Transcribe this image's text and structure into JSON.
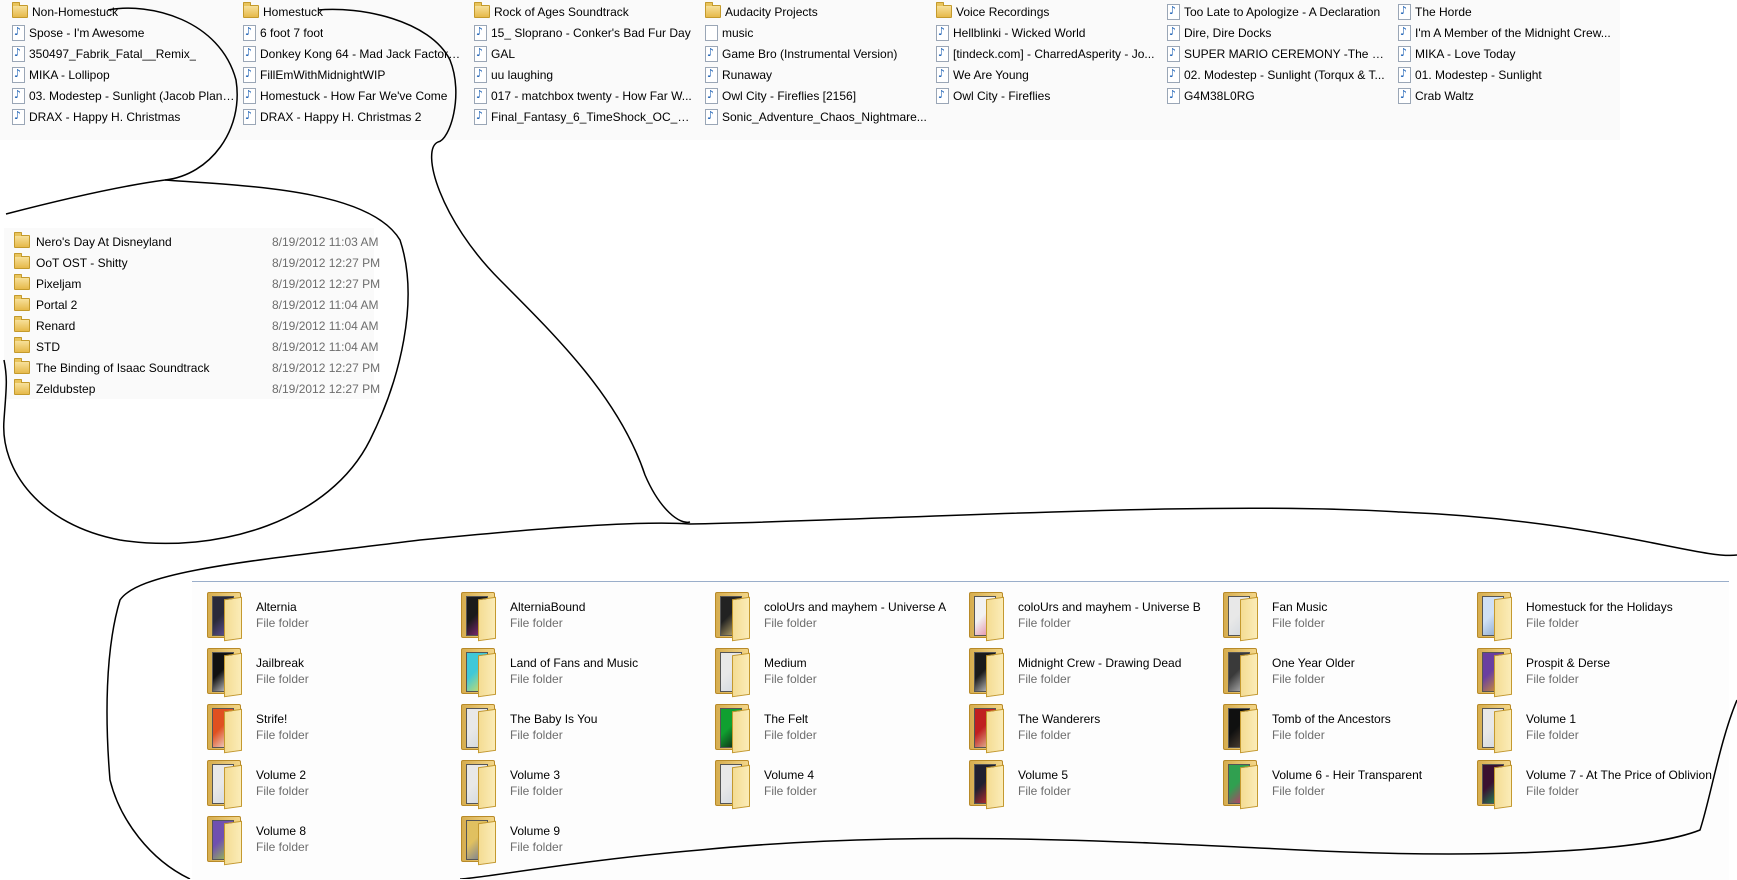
{
  "list_view": {
    "columns": [
      [
        {
          "label": "Non-Homestuck",
          "icon": "folder-icon"
        },
        {
          "label": "Spose - I'm Awesome",
          "icon": "audio-file-icon"
        },
        {
          "label": "350497_Fabrik_Fatal__Remix_",
          "icon": "audio-file-icon"
        },
        {
          "label": "MIKA - Lollipop",
          "icon": "audio-file-icon"
        },
        {
          "label": "03. Modestep - Sunlight (Jacob Plant...",
          "icon": "audio-file-icon"
        },
        {
          "label": "DRAX - Happy H. Christmas",
          "icon": "audio-file-icon"
        }
      ],
      [
        {
          "label": "Homestuck",
          "icon": "folder-icon"
        },
        {
          "label": "6 foot 7 foot",
          "icon": "audio-file-icon"
        },
        {
          "label": "Donkey Kong 64 - Mad Jack Factory ...",
          "icon": "audio-file-icon"
        },
        {
          "label": "FillEmWithMidnightWIP",
          "icon": "audio-file-icon"
        },
        {
          "label": "Homestuck - How Far We've Come",
          "icon": "audio-file-icon"
        },
        {
          "label": "DRAX - Happy H. Christmas 2",
          "icon": "audio-file-icon"
        }
      ],
      [
        {
          "label": "Rock of Ages Soundtrack",
          "icon": "folder-icon"
        },
        {
          "label": "15_ Sloprano - Conker's Bad Fur Day",
          "icon": "audio-file-icon"
        },
        {
          "label": "GAL",
          "icon": "audio-file-icon"
        },
        {
          "label": "uu laughing",
          "icon": "audio-file-icon"
        },
        {
          "label": "017 - matchbox twenty - How Far W...",
          "icon": "audio-file-icon"
        },
        {
          "label": "Final_Fantasy_6_TimeShock_OC_Re...",
          "icon": "audio-file-icon"
        }
      ],
      [
        {
          "label": "Audacity Projects",
          "icon": "folder-icon"
        },
        {
          "label": "music",
          "icon": "file-icon"
        },
        {
          "label": "Game Bro (Instrumental Version)",
          "icon": "audio-file-icon"
        },
        {
          "label": "Runaway",
          "icon": "audio-file-icon"
        },
        {
          "label": "Owl City - Fireflies  [2156]",
          "icon": "audio-file-icon"
        },
        {
          "label": "Sonic_Adventure_Chaos_Nightmare...",
          "icon": "audio-file-icon"
        }
      ],
      [
        {
          "label": "Voice Recordings",
          "icon": "folder-icon"
        },
        {
          "label": "Hellblinki - Wicked World",
          "icon": "audio-file-icon"
        },
        {
          "label": "[tindeck.com] - CharredAsperity - Jo...",
          "icon": "audio-file-icon"
        },
        {
          "label": "We Are Young",
          "icon": "audio-file-icon"
        },
        {
          "label": "Owl City - Fireflies",
          "icon": "audio-file-icon"
        }
      ],
      [
        {
          "label": "Too Late to Apologize - A Declaration",
          "icon": "audio-file-icon"
        },
        {
          "label": "Dire, Dire Docks",
          "icon": "audio-file-icon"
        },
        {
          "label": "SUPER MARIO CEREMONY -The 30t...",
          "icon": "audio-file-icon"
        },
        {
          "label": "02. Modestep - Sunlight (Torqux & T...",
          "icon": "audio-file-icon"
        },
        {
          "label": "G4M38L0RG",
          "icon": "audio-file-icon"
        }
      ],
      [
        {
          "label": "The Horde",
          "icon": "audio-file-icon"
        },
        {
          "label": "I'm A Member of the Midnight Crew...",
          "icon": "audio-file-icon"
        },
        {
          "label": "MIKA - Love Today",
          "icon": "audio-file-icon"
        },
        {
          "label": "01. Modestep - Sunlight",
          "icon": "audio-file-icon"
        },
        {
          "label": "Crab Waltz",
          "icon": "audio-file-icon"
        }
      ]
    ]
  },
  "details_view": {
    "rows": [
      {
        "name": "Nero's Day At Disneyland",
        "date": "8/19/2012 11:03 AM"
      },
      {
        "name": "OoT OST - Shitty",
        "date": "8/19/2012 12:27 PM"
      },
      {
        "name": "Pixeljam",
        "date": "8/19/2012 12:27 PM"
      },
      {
        "name": "Portal 2",
        "date": "8/19/2012 11:04 AM"
      },
      {
        "name": "Renard",
        "date": "8/19/2012 11:04 AM"
      },
      {
        "name": "STD",
        "date": "8/19/2012 11:04 AM"
      },
      {
        "name": "The Binding of Isaac Soundtrack",
        "date": "8/19/2012 12:27 PM"
      },
      {
        "name": "Zeldubstep",
        "date": "8/19/2012 12:27 PM"
      }
    ]
  },
  "tiles_view": {
    "type_label": "File folder",
    "items": [
      {
        "name": "Alternia",
        "art": [
          "#2a2a3a",
          "#6b5aa8"
        ]
      },
      {
        "name": "AlterniaBound",
        "art": [
          "#1a1a1a",
          "#9b2b8f"
        ]
      },
      {
        "name": "coloUrs and mayhem - Universe A",
        "art": [
          "#222222",
          "#d8c07a"
        ]
      },
      {
        "name": "coloUrs and mayhem - Universe B",
        "art": [
          "#f2f2f2",
          "#e07a9a"
        ]
      },
      {
        "name": "Fan Music",
        "art": [
          "#e8e8e8",
          "#cfd6de"
        ]
      },
      {
        "name": "Homestuck for the Holidays",
        "art": [
          "#cfe0f5",
          "#7f9fc8"
        ]
      },
      {
        "name": "Jailbreak",
        "art": [
          "#111111",
          "#f0f0f0"
        ]
      },
      {
        "name": "Land of Fans and Music",
        "art": [
          "#40c8d8",
          "#e8e050"
        ]
      },
      {
        "name": "Medium",
        "art": [
          "#e8e8e8",
          "#cfd6de"
        ]
      },
      {
        "name": "Midnight Crew - Drawing Dead",
        "art": [
          "#1a1a1a",
          "#e8e8e8"
        ]
      },
      {
        "name": "One Year Older",
        "art": [
          "#3a3a3a",
          "#c9c9c9"
        ]
      },
      {
        "name": "Prospit & Derse",
        "art": [
          "#6a3fa0",
          "#e0a020"
        ]
      },
      {
        "name": "Strife!",
        "art": [
          "#e05020",
          "#f0f0f0"
        ]
      },
      {
        "name": "The Baby Is You",
        "art": [
          "#e8e8e8",
          "#cfd6de"
        ]
      },
      {
        "name": "The Felt",
        "art": [
          "#10a030",
          "#101010"
        ]
      },
      {
        "name": "The Wanderers",
        "art": [
          "#c02020",
          "#e8d8b0"
        ]
      },
      {
        "name": "Tomb of the Ancestors",
        "art": [
          "#101010",
          "#5a4a3a"
        ]
      },
      {
        "name": "Volume 1",
        "art": [
          "#e8e8e8",
          "#cfd6de"
        ]
      },
      {
        "name": "Volume 2",
        "art": [
          "#e8e8e8",
          "#cfd6de"
        ]
      },
      {
        "name": "Volume 3",
        "art": [
          "#e8e8e8",
          "#cfd6de"
        ]
      },
      {
        "name": "Volume 4",
        "art": [
          "#e8e8e8",
          "#cfd6de"
        ]
      },
      {
        "name": "Volume 5",
        "art": [
          "#202030",
          "#e03030"
        ]
      },
      {
        "name": "Volume 6 - Heir Transparent",
        "art": [
          "#30a050",
          "#e02070"
        ]
      },
      {
        "name": "Volume 7 - At The Price of Oblivion",
        "art": [
          "#3a1030",
          "#20a060"
        ]
      },
      {
        "name": "Volume 8",
        "art": [
          "#7050b0",
          "#a0d040"
        ]
      },
      {
        "name": "Volume 9",
        "art": [
          "#e0c060",
          "#6070a0"
        ]
      }
    ]
  },
  "colors": {
    "scribble": "#000000",
    "pane_background": "#fafafa",
    "secondary_text": "#6d6d6d",
    "separator": "#9aaeca"
  }
}
